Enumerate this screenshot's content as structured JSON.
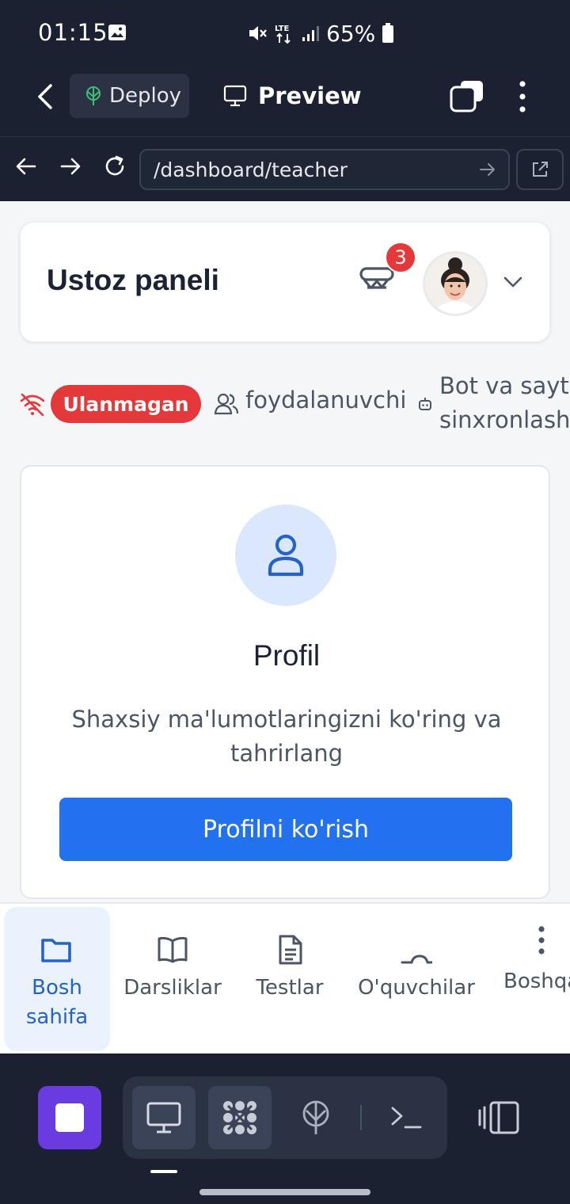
{
  "status_bar": {
    "time": "01:15",
    "network": "LTE",
    "battery": "65%"
  },
  "top_bar": {
    "deploy_label": "Deploy",
    "preview_label": "Preview"
  },
  "url_bar": {
    "url": "/dashboard/teacher"
  },
  "header": {
    "title": "Ustoz paneli",
    "notification_count": "3"
  },
  "connection": {
    "status_label": "Ulanmagan",
    "users_label": "foydalanuvchi",
    "sync_line1": "Bot va sayt",
    "sync_line2": "sinxronlash"
  },
  "profile_card": {
    "title": "Profil",
    "description": "Shaxsiy ma'lumotlaringizni ko'ring va tahrirlang",
    "button_label": "Profilni ko'rish"
  },
  "bottom_nav": {
    "items": [
      {
        "label": "Bosh sahifa",
        "line1": "Bosh",
        "line2": "sahifa",
        "icon": "folder-icon",
        "active": true
      },
      {
        "label": "Darsliklar",
        "icon": "book-icon",
        "active": false
      },
      {
        "label": "Testlar",
        "icon": "document-icon",
        "active": false
      },
      {
        "label": "O'quvchilar",
        "icon": "students-icon",
        "active": false
      },
      {
        "label": "Boshqa",
        "icon": "more-icon",
        "active": false
      }
    ]
  },
  "colors": {
    "accent": "#2272f0",
    "danger": "#e5383b",
    "dark_chrome": "#1b2130",
    "stop_button": "#6a3be0"
  }
}
